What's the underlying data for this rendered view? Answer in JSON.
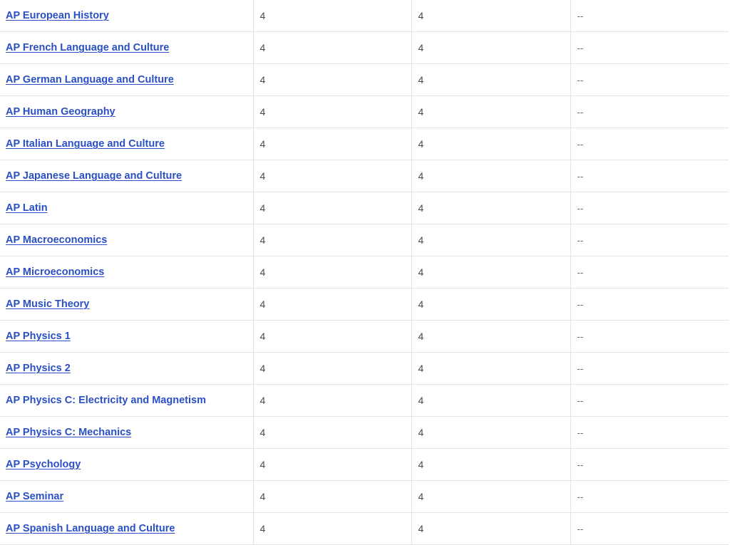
{
  "rows": [
    {
      "exam": "AP European History",
      "score_a": "4",
      "score_b": "4",
      "credit": "--",
      "underlined": true
    },
    {
      "exam": "AP French Language and Culture",
      "score_a": "4",
      "score_b": "4",
      "credit": "--",
      "underlined": true
    },
    {
      "exam": "AP German Language and Culture",
      "score_a": "4",
      "score_b": "4",
      "credit": "--",
      "underlined": true
    },
    {
      "exam": "AP Human Geography",
      "score_a": "4",
      "score_b": "4",
      "credit": "--",
      "underlined": true
    },
    {
      "exam": "AP Italian Language and Culture",
      "score_a": "4",
      "score_b": "4",
      "credit": "--",
      "underlined": true
    },
    {
      "exam": "AP Japanese Language and Culture",
      "score_a": "4",
      "score_b": "4",
      "credit": "--",
      "underlined": true
    },
    {
      "exam": "AP Latin",
      "score_a": "4",
      "score_b": "4",
      "credit": "--",
      "underlined": true
    },
    {
      "exam": "AP Macroeconomics",
      "score_a": "4",
      "score_b": "4",
      "credit": "--",
      "underlined": true
    },
    {
      "exam": "AP Microeconomics",
      "score_a": "4",
      "score_b": "4",
      "credit": "--",
      "underlined": true
    },
    {
      "exam": "AP Music Theory",
      "score_a": "4",
      "score_b": "4",
      "credit": "--",
      "underlined": true
    },
    {
      "exam": "AP Physics 1",
      "score_a": "4",
      "score_b": "4",
      "credit": "--",
      "underlined": true
    },
    {
      "exam": "AP Physics 2",
      "score_a": "4",
      "score_b": "4",
      "credit": "--",
      "underlined": true
    },
    {
      "exam": "AP Physics C: Electricity and Magnetism",
      "score_a": "4",
      "score_b": "4",
      "credit": "--",
      "underlined": false
    },
    {
      "exam": "AP Physics C: Mechanics",
      "score_a": "4",
      "score_b": "4",
      "credit": "--",
      "underlined": true
    },
    {
      "exam": "AP Psychology",
      "score_a": "4",
      "score_b": "4",
      "credit": "--",
      "underlined": true
    },
    {
      "exam": "AP Seminar",
      "score_a": "4",
      "score_b": "4",
      "credit": "--",
      "underlined": true
    },
    {
      "exam": "AP Spanish Language and Culture",
      "score_a": "4",
      "score_b": "4",
      "credit": "--",
      "underlined": true
    }
  ],
  "colors": {
    "link": "#2b4fc4",
    "text": "#4a4a4a",
    "border": "#e3e3e3"
  }
}
